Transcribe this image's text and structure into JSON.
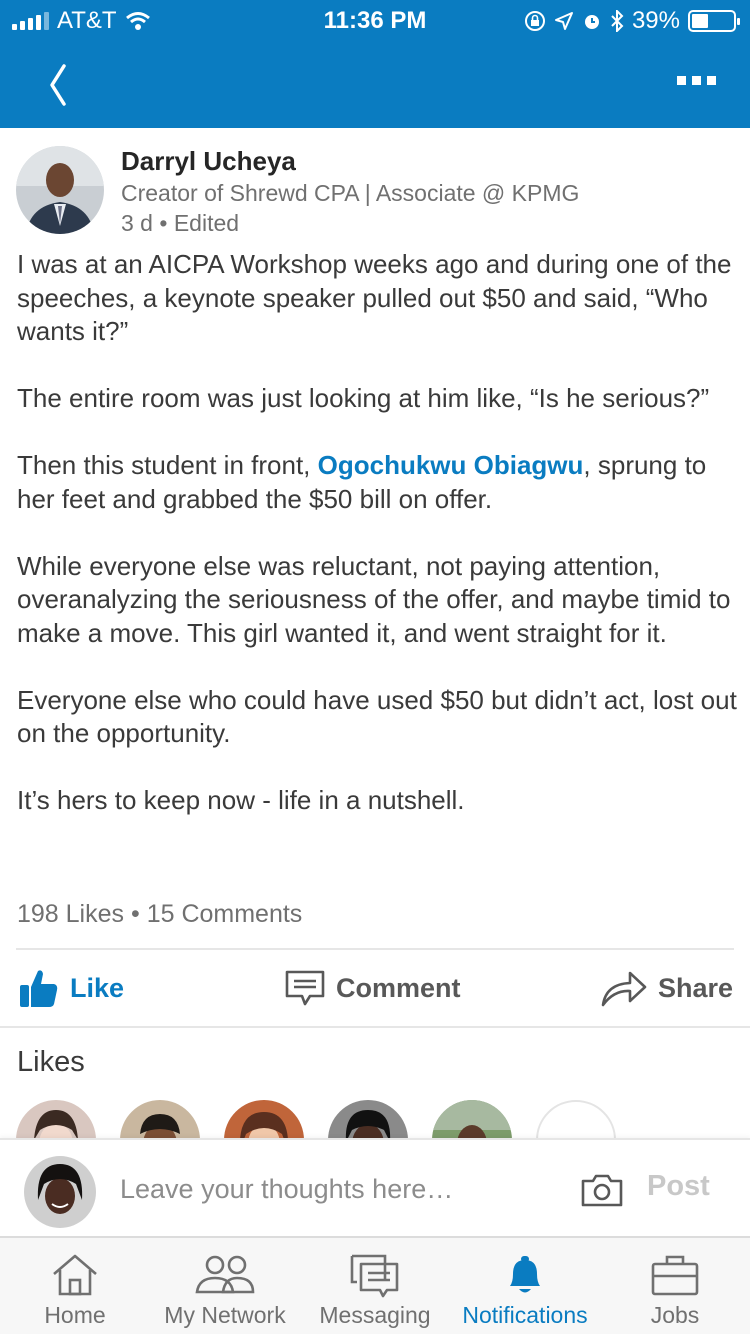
{
  "status_bar": {
    "carrier": "AT&T",
    "time": "11:36 PM",
    "battery": "39%",
    "battery_level": 0.39
  },
  "nav": {
    "back_icon": "chevron-left-icon",
    "more_icon": "more-dots-icon"
  },
  "post": {
    "author": "Darryl Ucheya",
    "headline": "Creator of Shrewd CPA | Associate @ KPMG",
    "time": "3 d",
    "edited": "Edited",
    "paragraphs": {
      "p1": "I was at an AICPA Workshop weeks ago and during one of the speeches, a keynote speaker pulled out $50 and said, “Who wants it?”",
      "p2": "The entire room was just looking at him like, “Is he serious?”",
      "p3_before": "Then this student in front, ",
      "p3_mention": "Ogochukwu Obiagwu",
      "p3_after": ", sprung to her feet and grabbed the $50 bill on offer.",
      "p4": "While everyone else was reluctant, not paying attention, overanalyzing the seriousness of the offer, and maybe timid to make a move. This girl wanted it, and went straight for it.",
      "p5": "Everyone else who could have used $50 but didn’t act, lost out on the opportunity.",
      "p6": "It’s hers to keep now - life in a nutshell."
    },
    "likes_count": "198 Likes",
    "comments_count": "15 Comments"
  },
  "actions": {
    "like": "Like",
    "comment": "Comment",
    "share": "Share"
  },
  "likes_section": {
    "title": "Likes"
  },
  "composer": {
    "placeholder": "Leave your thoughts here…",
    "post": "Post"
  },
  "tabs": {
    "home": "Home",
    "network": "My Network",
    "messaging": "Messaging",
    "notifications": "Notifications",
    "jobs": "Jobs"
  },
  "colors": {
    "brand": "#0a7cc1",
    "text": "#3a3a3a",
    "muted": "#707070"
  }
}
